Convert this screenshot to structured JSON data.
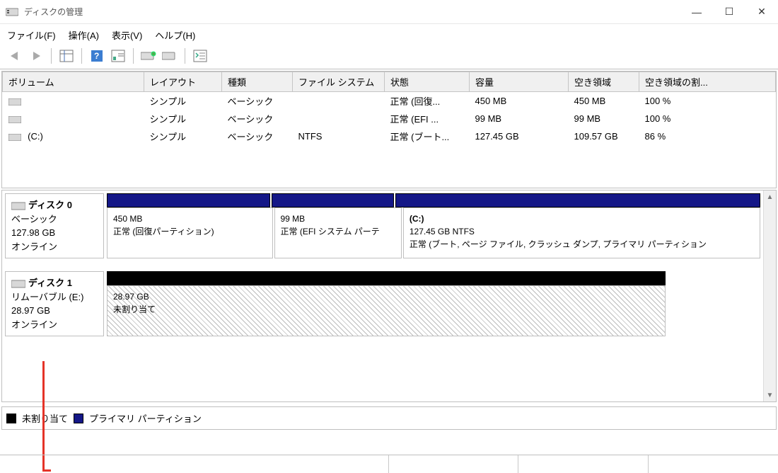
{
  "window": {
    "title": "ディスクの管理",
    "minimize": "—",
    "maximize": "☐",
    "close": "✕"
  },
  "menu": {
    "file": "ファイル(F)",
    "action": "操作(A)",
    "view": "表示(V)",
    "help": "ヘルプ(H)"
  },
  "columns": {
    "volume": "ボリューム",
    "layout": "レイアウト",
    "type": "種類",
    "filesystem": "ファイル システム",
    "status": "状態",
    "capacity": "容量",
    "free": "空き領域",
    "pctfree": "空き領域の割..."
  },
  "rows": [
    {
      "name": "",
      "layout": "シンプル",
      "type": "ベーシック",
      "fs": "",
      "status": "正常 (回復...",
      "capacity": "450 MB",
      "free": "450 MB",
      "pct": "100 %"
    },
    {
      "name": "",
      "layout": "シンプル",
      "type": "ベーシック",
      "fs": "",
      "status": "正常 (EFI ...",
      "capacity": "99 MB",
      "free": "99 MB",
      "pct": "100 %"
    },
    {
      "name": "(C:)",
      "layout": "シンプル",
      "type": "ベーシック",
      "fs": "NTFS",
      "status": "正常 (ブート...",
      "capacity": "127.45 GB",
      "free": "109.57 GB",
      "pct": "86 %"
    }
  ],
  "disk0": {
    "name": "ディスク 0",
    "type": "ベーシック",
    "capacity": "127.98 GB",
    "state": "オンライン",
    "parts": [
      {
        "title": "",
        "size": "450 MB",
        "desc": "正常 (回復パーティション)"
      },
      {
        "title": "",
        "size": "99 MB",
        "desc": "正常 (EFI システム パーテ"
      },
      {
        "title": "(C:)",
        "size": "127.45 GB NTFS",
        "desc": "正常 (ブート, ページ ファイル, クラッシュ ダンプ, プライマリ パーティション"
      }
    ]
  },
  "disk1": {
    "name": "ディスク 1",
    "type": "リムーバブル (E:)",
    "capacity": "28.97 GB",
    "state": "オンライン",
    "part": {
      "size": "28.97 GB",
      "desc": "未割り当て"
    }
  },
  "legend": {
    "unallocated": "未割り当て",
    "primary": "プライマリ パーティション"
  }
}
